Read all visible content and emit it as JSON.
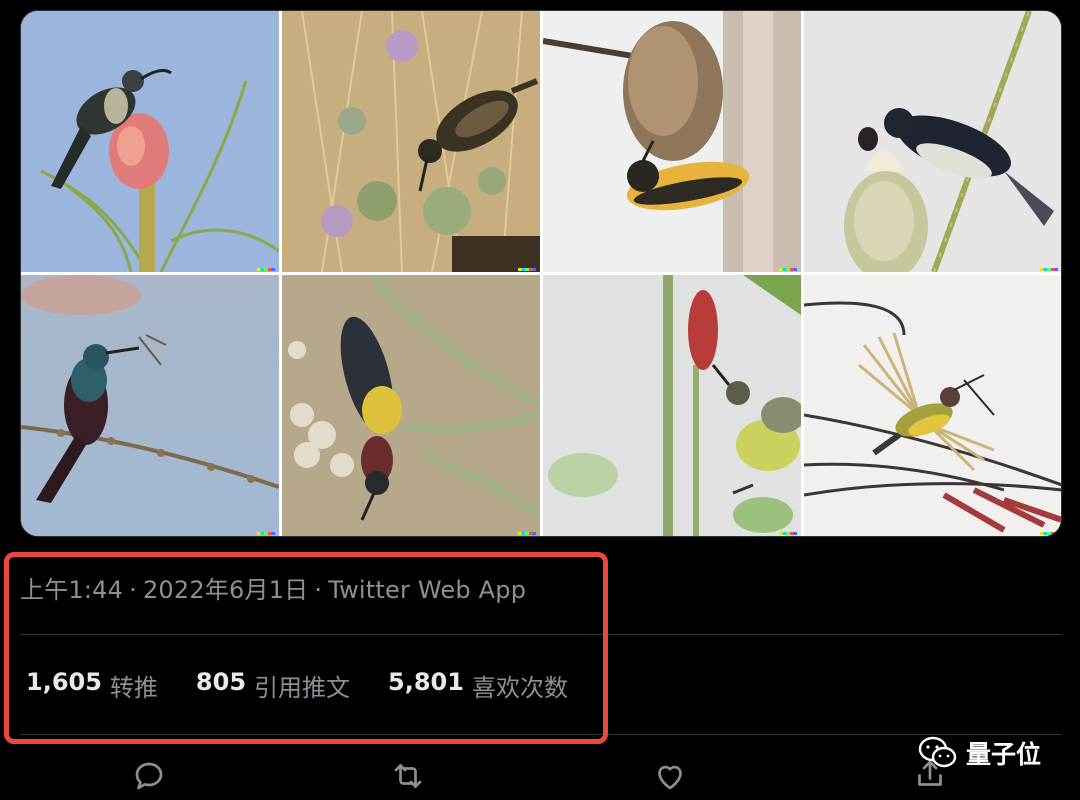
{
  "tweet": {
    "time": "上午1:44",
    "separator": "·",
    "date": "2022年6月1日",
    "source": "Twitter Web App",
    "stats": [
      {
        "count": "1,605",
        "label": "转推"
      },
      {
        "count": "805",
        "label": "引用推文"
      },
      {
        "count": "5,801",
        "label": "喜欢次数"
      }
    ],
    "images_count": 8
  },
  "actions": {
    "icons": [
      "reply-icon",
      "retweet-icon",
      "like-icon",
      "share-icon"
    ]
  },
  "watermark": {
    "text": "量子位",
    "icon": "wechat-icon"
  },
  "colors": {
    "background": "#000000",
    "primary_text": "#e7e9ea",
    "secondary_text": "#8b9095",
    "divider": "#2f3336",
    "highlight_border": "#e8483f"
  }
}
